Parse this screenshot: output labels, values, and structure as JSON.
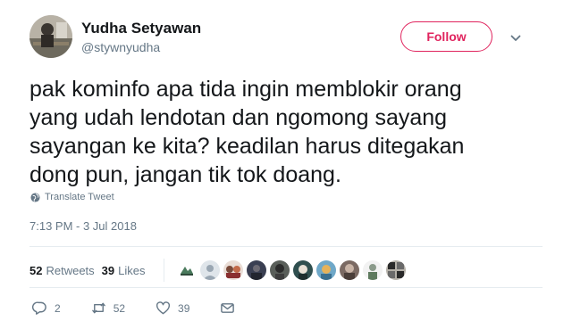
{
  "user": {
    "display_name": "Yudha Setyawan",
    "username": "@stywnyudha"
  },
  "follow_label": "Follow",
  "tweet": {
    "lines": [
      "pak kominfo apa tida ingin memblokir orang",
      "yang udah lendotan dan ngomong sayang",
      "sayangan ke kita? keadilan harus ditegakan",
      "dong pun, jangan tik tok doang."
    ],
    "translate_label": "Translate Tweet",
    "timestamp": "7:13 PM - 3 Jul 2018"
  },
  "stats": {
    "retweets_count": "52",
    "retweets_label": "Retweets",
    "likes_count": "39",
    "likes_label": "Likes",
    "liker_avatar_colors": [
      "#4a7a5c",
      "#9aa7b3",
      "#7a4a3a",
      "#3a3f52",
      "#5a5f5a",
      "#2f4f4f",
      "#6fa8c8",
      "#7b6a63",
      "#8a9a8a",
      "#b4b0a8"
    ]
  },
  "actions": {
    "replies_count": "2",
    "retweets_count": "52",
    "likes_count": "39"
  },
  "icons": {
    "caret": "chevron-down-icon",
    "globe": "globe-icon",
    "reply": "reply-icon",
    "retweet": "retweet-icon",
    "like": "heart-icon",
    "message": "envelope-icon"
  },
  "colors": {
    "follow_accent": "#e0245e",
    "secondary_text": "#657786",
    "primary_text": "#14171a"
  }
}
